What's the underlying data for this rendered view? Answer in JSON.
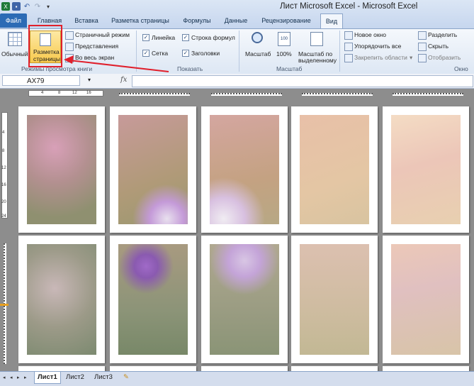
{
  "window": {
    "title": "Лист Microsoft Excel  -  Microsoft Excel"
  },
  "tabs": {
    "file": "Файл",
    "home": "Главная",
    "insert": "Вставка",
    "page_layout": "Разметка страницы",
    "formulas": "Формулы",
    "data": "Данные",
    "review": "Рецензирование",
    "view": "Вид"
  },
  "ribbon": {
    "views": {
      "normal": "Обычный",
      "page_layout_line1": "Разметка",
      "page_layout_line2": "страницы",
      "page_break": "Страничный режим",
      "custom": "Представления",
      "fullscreen": "Во весь экран",
      "group": "Режимы просмотра книги"
    },
    "show": {
      "ruler": "Линейка",
      "formula_bar": "Строка формул",
      "gridlines": "Сетка",
      "headings": "Заголовки",
      "group": "Показать"
    },
    "zoom": {
      "zoom": "Масштаб",
      "hundred": "100%",
      "selection_line1": "Масштаб по",
      "selection_line2": "выделенному",
      "group": "Масштаб"
    },
    "window": {
      "new": "Новое окно",
      "arrange": "Упорядочить все",
      "freeze": "Закрепить области",
      "split": "Разделить",
      "hide": "Скрыть",
      "unhide": "Отобразить",
      "group": "Окно"
    }
  },
  "formula_bar": {
    "name_box": "AX79",
    "fx": "fx",
    "value": ""
  },
  "ruler": {
    "h_ticks": [
      "4",
      "8",
      "12",
      "16"
    ],
    "v_ticks": [
      "4",
      "8",
      "12",
      "16",
      "20",
      "24"
    ]
  },
  "sheet_tabs": [
    "Лист1",
    "Лист2",
    "Лист3"
  ],
  "colors": {
    "file_tab": "#2c6bb5",
    "highlight": "#e0202c",
    "sheet_bg": "#8d8d8d"
  }
}
